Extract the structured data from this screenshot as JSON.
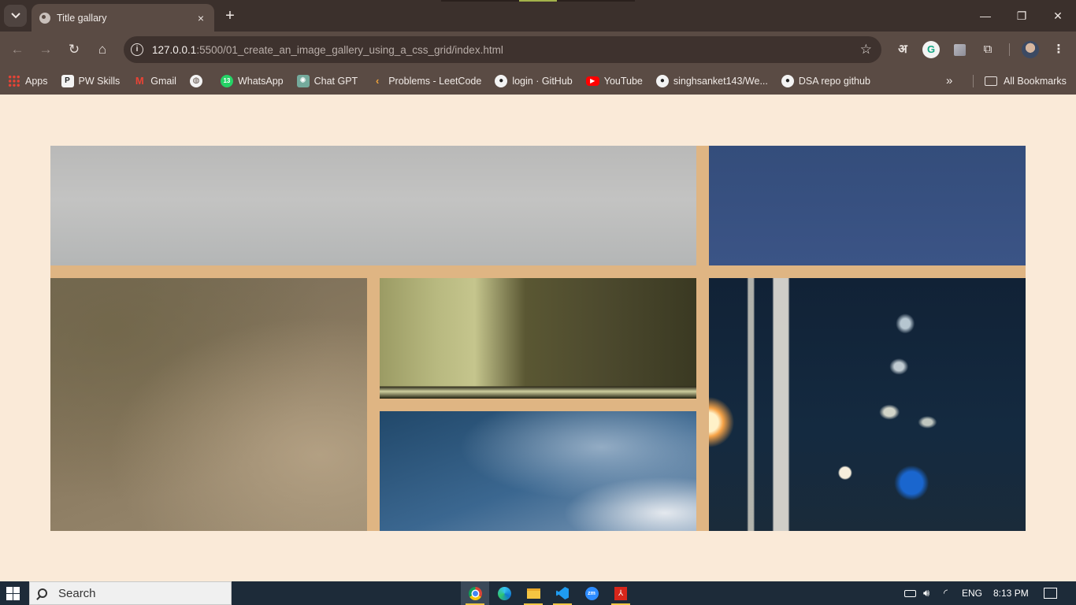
{
  "browser": {
    "tab": {
      "title": "Title gallary",
      "close_icon": "×"
    },
    "new_tab_label": "+",
    "window_controls": {
      "minimize": "—",
      "restore": "❐",
      "close": "✕"
    },
    "nav": {
      "back": "←",
      "forward": "→",
      "reload": "↻",
      "home": "⌂"
    },
    "address": {
      "host": "127.0.0.1",
      "path": ":5500/01_create_an_image_gallery_using_a_css_grid/index.html",
      "star": "☆"
    },
    "extensions": {
      "translate": "अ",
      "grammarly": "G",
      "puzzle": "⧉",
      "menu": "⋮"
    },
    "bookmarks": [
      {
        "label": "Apps",
        "icon": "apps-icon",
        "glyph": ""
      },
      {
        "label": "PW Skills",
        "icon": "pw-skills-icon",
        "glyph": "P"
      },
      {
        "label": "Gmail",
        "icon": "gmail-icon",
        "glyph": "M"
      },
      {
        "label": "",
        "icon": "globe-icon",
        "glyph": "◍"
      },
      {
        "label": "WhatsApp",
        "icon": "whatsapp-icon",
        "glyph": "13"
      },
      {
        "label": "Chat GPT",
        "icon": "chatgpt-icon",
        "glyph": "✺"
      },
      {
        "label": "Problems - LeetCode",
        "icon": "leetcode-icon",
        "glyph": "‹"
      },
      {
        "label": "login · GitHub",
        "icon": "github-icon",
        "glyph": "●"
      },
      {
        "label": "YouTube",
        "icon": "youtube-icon",
        "glyph": "▶"
      },
      {
        "label": "singhsanket143/We...",
        "icon": "github-icon",
        "glyph": "●"
      },
      {
        "label": "DSA repo github",
        "icon": "github-icon",
        "glyph": "●"
      }
    ],
    "bookmarks_more": "»",
    "all_bookmarks": "All Bookmarks"
  },
  "page": {
    "background": "#faead8",
    "gallery_gap_color": "#dfb583",
    "images": [
      {
        "name": "gallery-image-clouds-grey",
        "alt": ""
      },
      {
        "name": "gallery-image-blue-sky",
        "alt": ""
      },
      {
        "name": "gallery-image-brown-texture",
        "alt": ""
      },
      {
        "name": "gallery-image-olive-wall",
        "alt": ""
      },
      {
        "name": "gallery-image-sky-clouds",
        "alt": ""
      },
      {
        "name": "gallery-image-city-lights",
        "alt": ""
      }
    ]
  },
  "taskbar": {
    "search_label": "Search",
    "language": "ENG",
    "time": "8:13 PM",
    "apps": [
      "chrome-icon",
      "edge-icon",
      "file-explorer-icon",
      "vscode-icon",
      "zoom-icon",
      "acrobat-icon"
    ],
    "zoom_glyph": "zm",
    "pdf_glyph": "⅄"
  }
}
